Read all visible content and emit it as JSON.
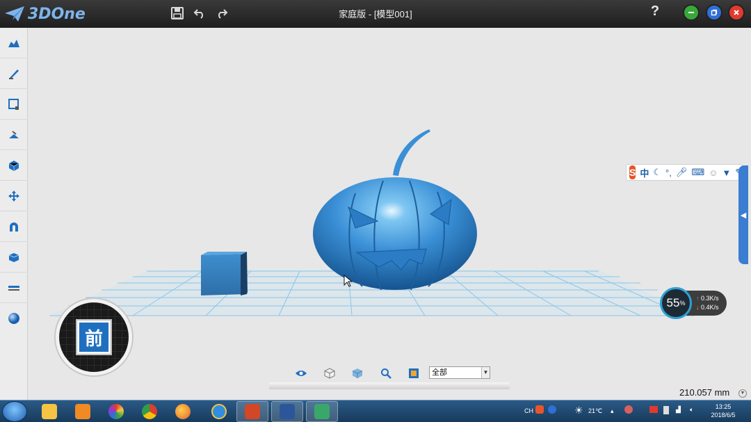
{
  "app": {
    "logo_text": "3DOne",
    "window_title": "家庭版 - [模型001]",
    "help_label": "?"
  },
  "titlebar_icons": [
    "save-icon",
    "undo-icon",
    "redo-icon"
  ],
  "window_controls": {
    "minimize_color": "#3aa73a",
    "restore_color": "#2f6fd6",
    "close_color": "#e03a2f"
  },
  "left_toolbar": [
    "basic-solid-icon",
    "sketch-icon",
    "sketch-edit-icon",
    "feature-icon",
    "special-feature-icon",
    "move-icon",
    "adsorb-icon",
    "combine-icon",
    "distance-icon",
    "material-icon"
  ],
  "ime_bar": {
    "logo": "S",
    "mode": "中",
    "icons": [
      "moon-icon",
      "punctuation-icon",
      "microphone-icon",
      "keyboard-icon",
      "user-icon",
      "shirt-icon",
      "wrench-icon"
    ]
  },
  "net_widget": {
    "percent": "55",
    "percent_unit": "%",
    "upload": "0.3K/s",
    "download": "0.4K/s"
  },
  "viewcube": {
    "face_label": "前"
  },
  "view_toolbar": {
    "icons": [
      "eye-icon",
      "wireframe-cube-icon",
      "shaded-cube-icon",
      "zoom-icon",
      "view-fit-icon"
    ],
    "select_value": "全部"
  },
  "status": {
    "measurement": "210.057 mm"
  },
  "taskbar": {
    "apps": [
      "explorer-icon",
      "media-player-icon",
      "picasa-icon",
      "chrome-icon",
      "firefox-icon",
      "ie-icon",
      "powerpoint-icon",
      "word-icon",
      "3done-icon"
    ],
    "tray": {
      "language": "CH",
      "weather": "21℃",
      "time": "13:25",
      "date": "2018/6/5"
    }
  },
  "colors": {
    "model_blue": "#3a8fd6",
    "grid_line": "#7fc3ea",
    "accent": "#1f6fc0"
  }
}
